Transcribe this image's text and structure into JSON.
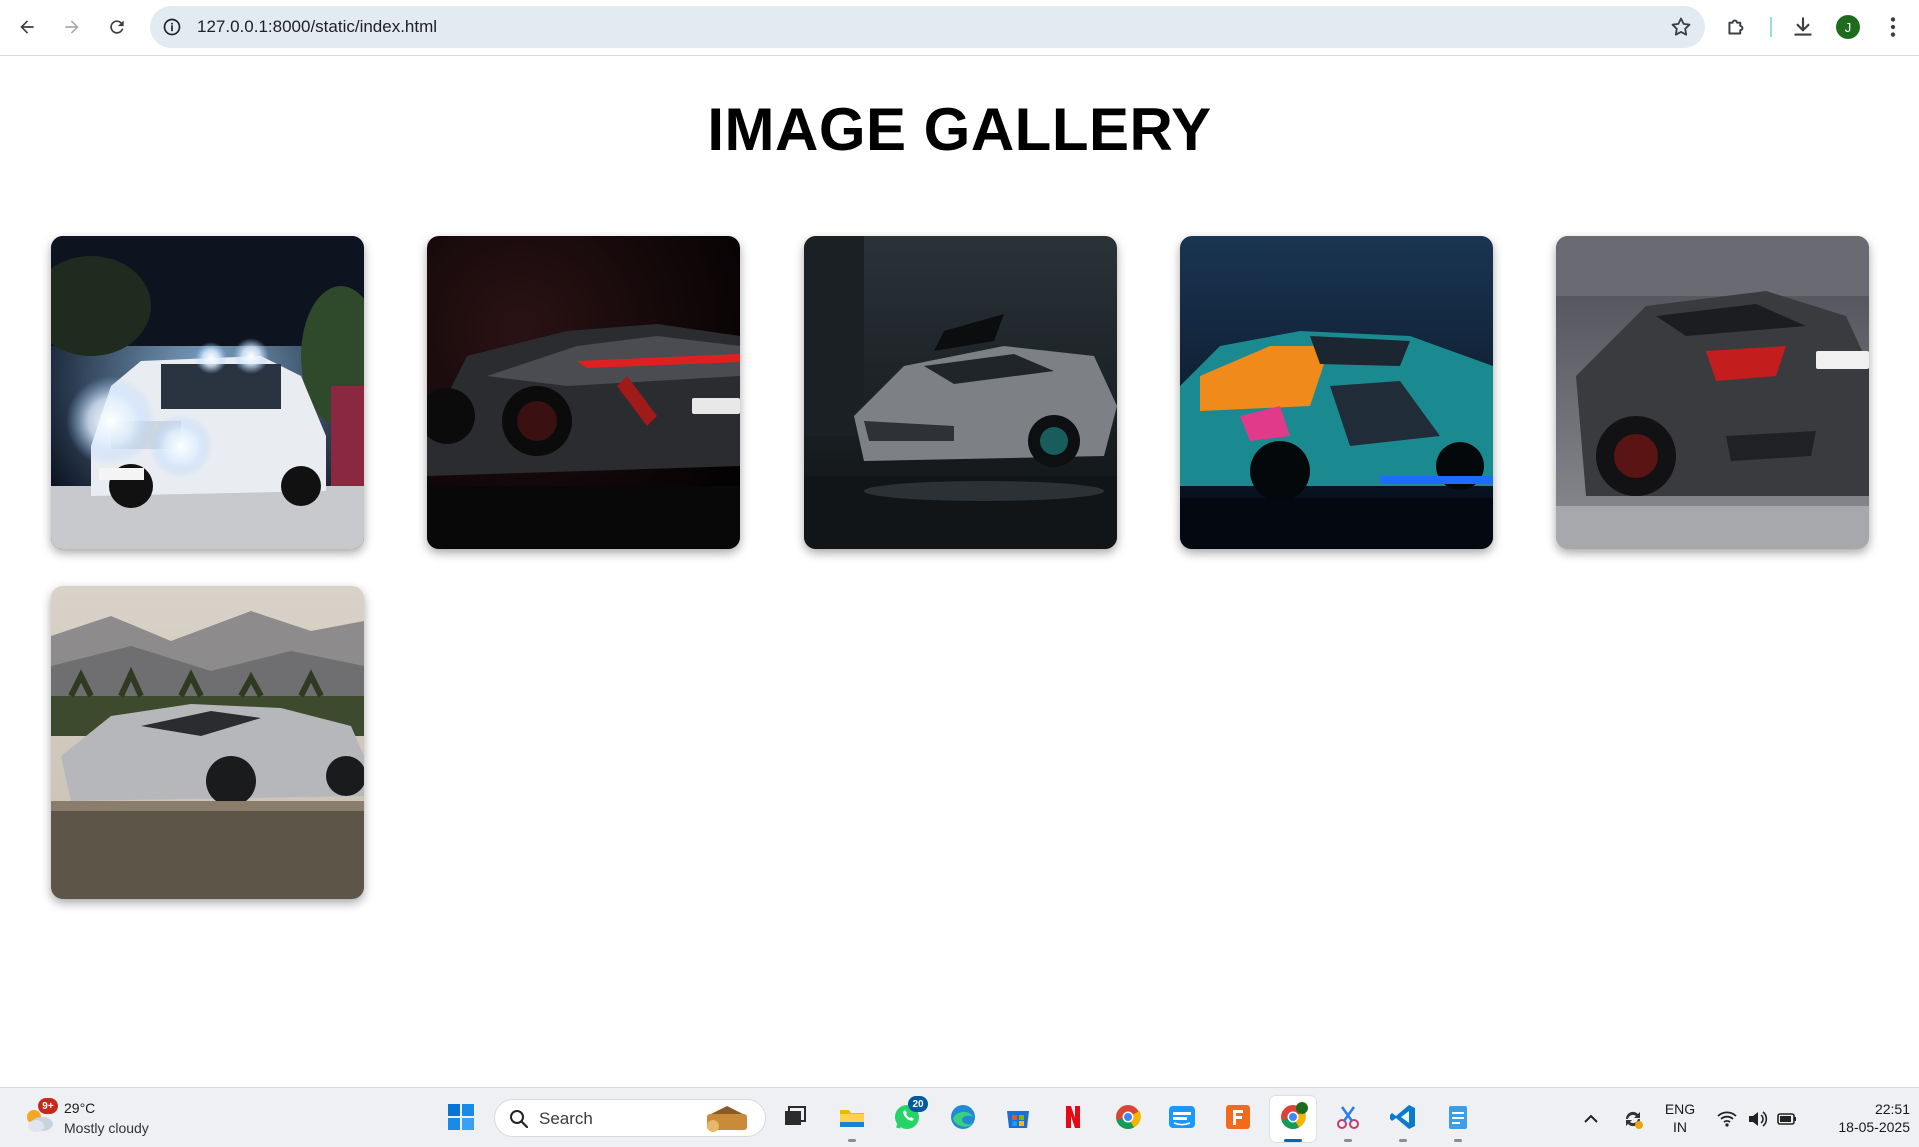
{
  "browser": {
    "url": "127.0.0.1:8000/static/index.html",
    "profile_initial": "J",
    "icons": [
      "back-arrow-icon",
      "forward-arrow-icon",
      "reload-icon",
      "site-info-icon",
      "bookmark-star-icon",
      "extensions-icon",
      "download-icon",
      "more-menu-icon"
    ]
  },
  "page": {
    "title": "IMAGE GALLERY",
    "images": [
      {
        "subject": "white off-road SUV with lights at night"
      },
      {
        "subject": "dark red-lit hypercar"
      },
      {
        "subject": "grey hypercar in dark garage"
      },
      {
        "subject": "colorful livery racing coupe"
      },
      {
        "subject": "matte grey coupe rear view"
      },
      {
        "subject": "silver hypercar in desert"
      }
    ]
  },
  "taskbar": {
    "weather": {
      "temp": "29°C",
      "desc": "Mostly cloudy",
      "badge": "9+"
    },
    "search_placeholder": "Search",
    "whatsapp_badge": "20",
    "chrome_profile_initial": "J",
    "language": {
      "line1": "ENG",
      "line2": "IN"
    },
    "clock": {
      "time": "22:51",
      "date": "18-05-2025"
    },
    "app_icons": [
      "windows-start-icon",
      "task-view-icon",
      "file-explorer-icon",
      "whatsapp-icon",
      "edge-icon",
      "microsoft-store-icon",
      "netflix-icon",
      "chrome-icon",
      "prime-video-icon",
      "fus-app-icon",
      "chrome-profile-icon",
      "snipping-tool-icon",
      "vscode-icon",
      "notepad-icon"
    ],
    "colors": {
      "accent": "#0067c0",
      "netflix": "#e50914"
    }
  }
}
